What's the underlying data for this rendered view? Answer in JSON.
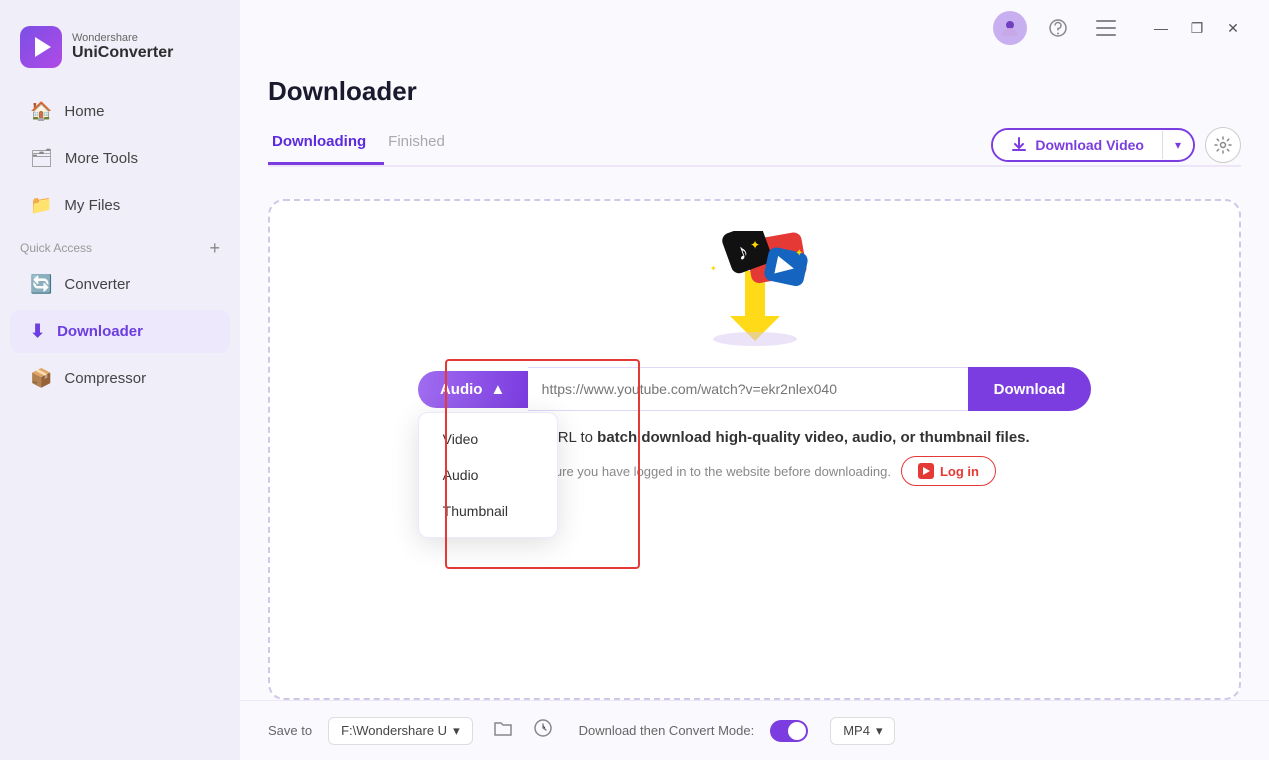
{
  "app": {
    "brand": "Wondershare",
    "product": "UniConverter"
  },
  "sidebar": {
    "items": [
      {
        "id": "home",
        "label": "Home",
        "icon": "🏠",
        "active": false
      },
      {
        "id": "more-tools",
        "label": "More Tools",
        "icon": "🗂",
        "active": false
      },
      {
        "id": "my-files",
        "label": "My Files",
        "icon": "📁",
        "active": false
      },
      {
        "id": "converter",
        "label": "Converter",
        "icon": "🔄",
        "active": false
      },
      {
        "id": "downloader",
        "label": "Downloader",
        "icon": "⬇",
        "active": true
      },
      {
        "id": "compressor",
        "label": "Compressor",
        "icon": "📦",
        "active": false
      }
    ],
    "quick_access_label": "Quick Access",
    "add_label": "+"
  },
  "topbar": {
    "avatar_title": "User profile",
    "headset_title": "Support",
    "menu_title": "Menu",
    "minimize_label": "—",
    "maximize_label": "❐",
    "close_label": "✕"
  },
  "page": {
    "title": "Downloader",
    "tabs": [
      {
        "id": "downloading",
        "label": "Downloading",
        "active": true
      },
      {
        "id": "finished",
        "label": "Finished",
        "active": false
      }
    ],
    "download_video_btn": "Download Video",
    "settings_title": "Settings"
  },
  "content": {
    "url_placeholder": "https://www.youtube.com/watch?v=ekr2nlex040",
    "download_btn_label": "Download",
    "type_selected": "Audio",
    "type_arrow": "▲",
    "dropdown_items": [
      "Video",
      "Audio",
      "Thumbnail"
    ],
    "paste_hint": "Paste the URL to batch download high-quality video, audio, or thumbnail files.",
    "login_hint": "Make sure you have logged in to the website before downloading.",
    "login_btn": "Log in"
  },
  "bottom": {
    "save_label": "Save to",
    "save_path": "F:\\Wondershare U",
    "convert_mode_label": "Download then Convert Mode:",
    "format_label": "MP4"
  }
}
